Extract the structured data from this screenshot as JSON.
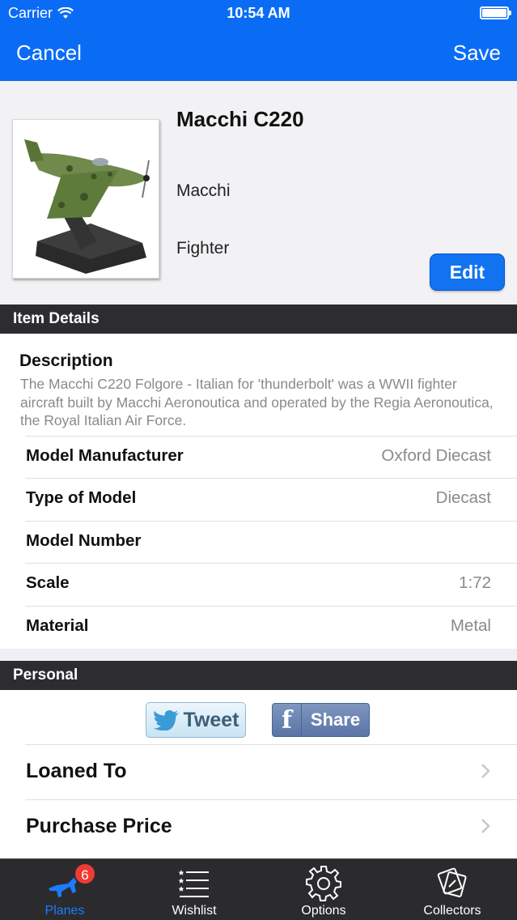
{
  "status_bar": {
    "carrier": "Carrier",
    "time": "10:54 AM"
  },
  "nav": {
    "cancel_label": "Cancel",
    "save_label": "Save",
    "accent": "#0a6cf5"
  },
  "item": {
    "name": "Macchi C220",
    "manufacturer": "Macchi",
    "type": "Fighter",
    "edit_label": "Edit"
  },
  "sections": {
    "details_title": "Item Details",
    "personal_title": "Personal"
  },
  "description": {
    "heading": "Description",
    "text": "The Macchi C220 Folgore - Italian for 'thunderbolt' was a WWII fighter aircraft built by Macchi Aeronoutica and operated by the Regia Aeronoutica, the Royal Italian Air Force."
  },
  "details": [
    {
      "label": "Model Manufacturer",
      "value": "Oxford Diecast"
    },
    {
      "label": "Type of Model",
      "value": "Diecast"
    },
    {
      "label": "Model Number",
      "value": ""
    },
    {
      "label": "Scale",
      "value": "1:72"
    },
    {
      "label": "Material",
      "value": "Metal"
    }
  ],
  "social": {
    "tweet_label": "Tweet",
    "share_label": "Share"
  },
  "personal_rows": [
    {
      "label": "Loaned To"
    },
    {
      "label": "Purchase Price"
    }
  ],
  "tabs": [
    {
      "label": "Planes",
      "icon": "plane-icon",
      "badge": "6",
      "active": true
    },
    {
      "label": "Wishlist",
      "icon": "list-icon",
      "active": false
    },
    {
      "label": "Options",
      "icon": "gear-icon",
      "active": false
    },
    {
      "label": "Collectors",
      "icon": "collectors-icon",
      "active": false
    }
  ]
}
